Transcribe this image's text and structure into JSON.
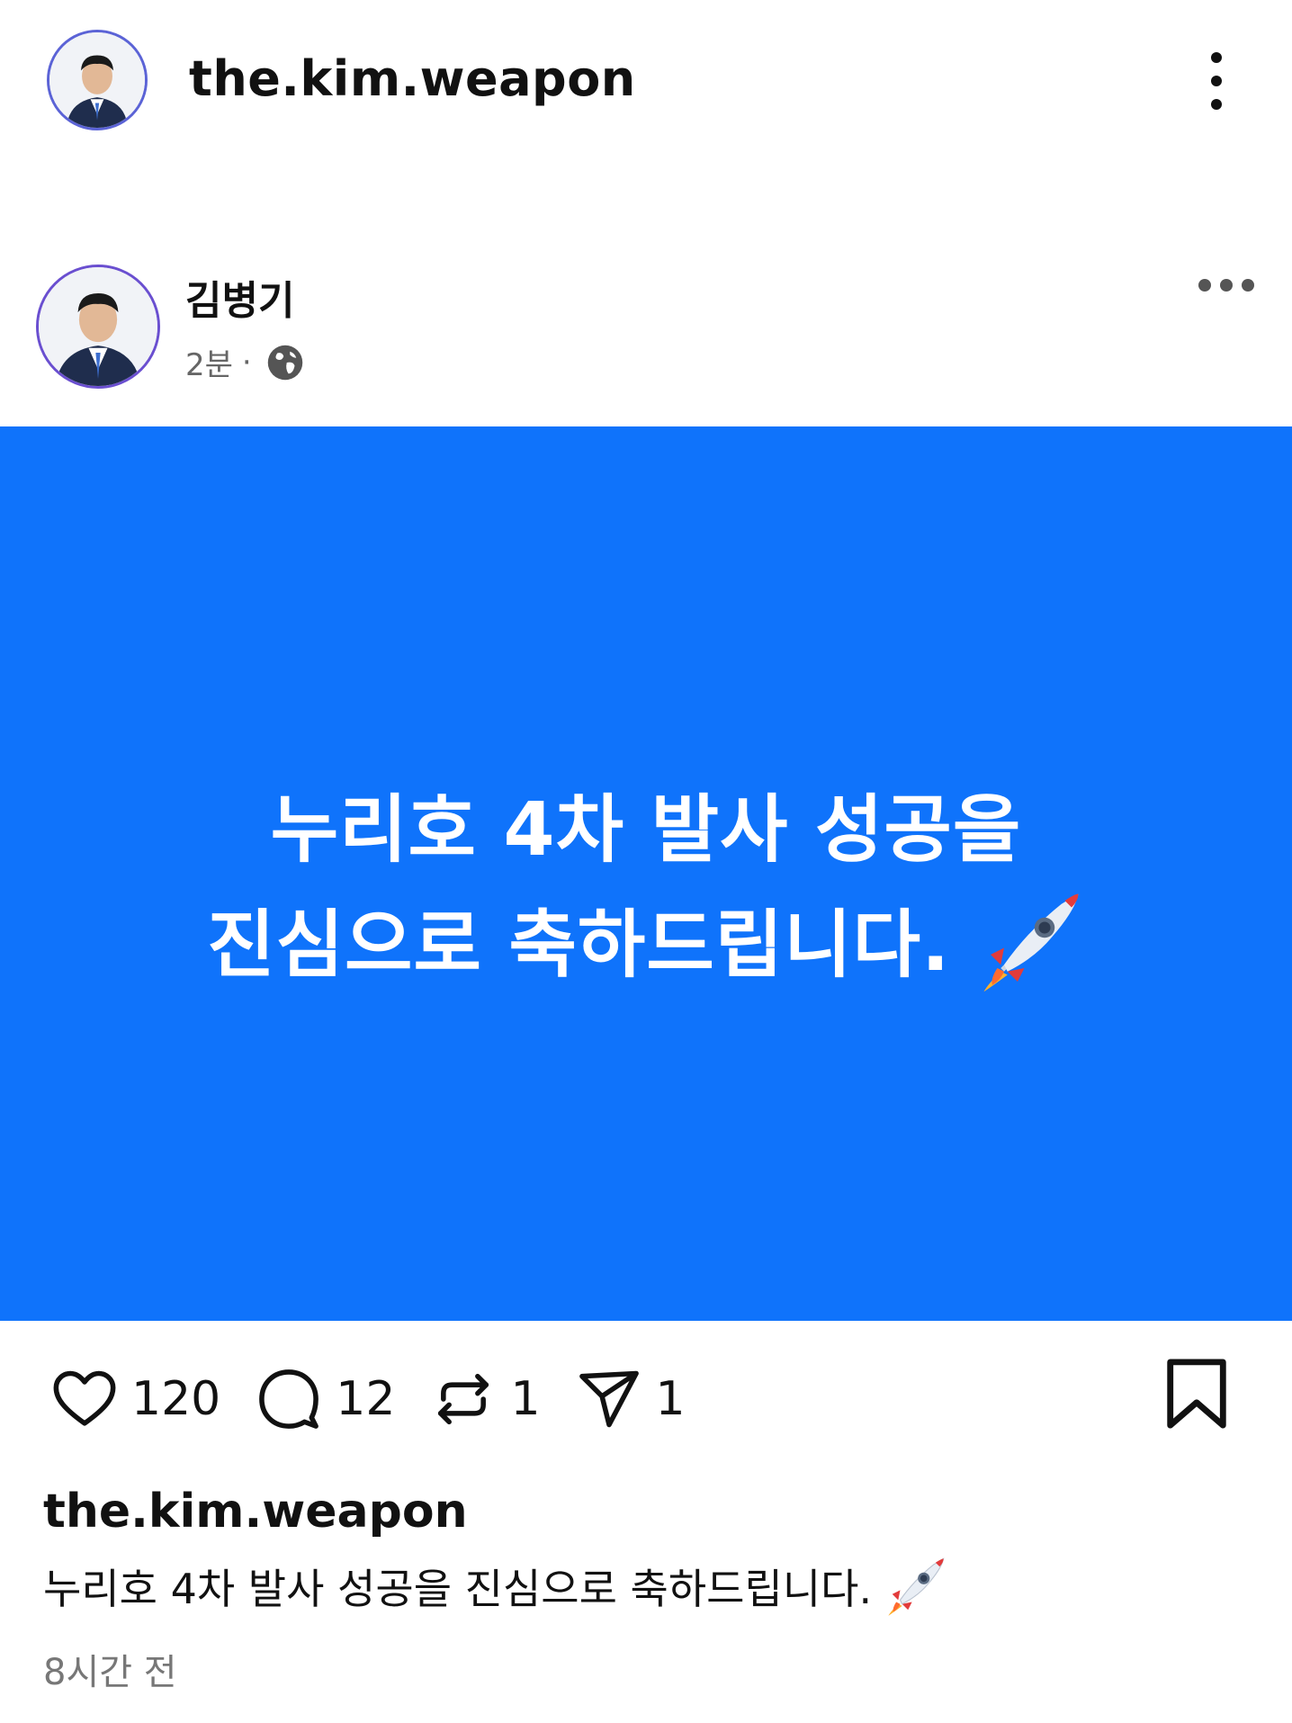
{
  "header": {
    "username": "the.kim.weapon",
    "menu_icon": "kebab-vertical-icon"
  },
  "post": {
    "author_name": "김병기",
    "time_ago": "2분",
    "separator": "·",
    "visibility_icon": "globe-icon",
    "more_icon": "more-horizontal-icon",
    "image": {
      "background_color": "#0f73fb",
      "line1": "누리호 4차 발사 성공을",
      "line2": "진심으로 축하드립니다.",
      "emoji": "rocket-icon"
    }
  },
  "actions": {
    "like_count": "120",
    "comment_count": "12",
    "repost_count": "1",
    "share_count": "1"
  },
  "caption": {
    "username": "the.kim.weapon",
    "text": "누리호 4차 발사 성공을 진심으로 축하드립니다.",
    "time": "8시간 전"
  }
}
